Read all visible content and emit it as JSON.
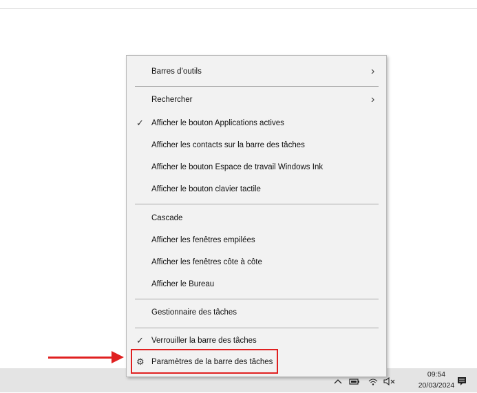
{
  "menu": {
    "items": [
      {
        "label": "Barres d’outils",
        "submenu": true,
        "checked": false
      },
      {
        "label": "Rechercher",
        "submenu": true,
        "checked": false
      },
      {
        "label": "Afficher le bouton Applications actives",
        "submenu": false,
        "checked": true
      },
      {
        "label": "Afficher les contacts sur la barre des tâches",
        "submenu": false,
        "checked": false
      },
      {
        "label": "Afficher le bouton Espace de travail Windows Ink",
        "submenu": false,
        "checked": false
      },
      {
        "label": "Afficher le bouton clavier tactile",
        "submenu": false,
        "checked": false
      },
      {
        "label": "Cascade",
        "submenu": false,
        "checked": false
      },
      {
        "label": "Afficher les fenêtres empilées",
        "submenu": false,
        "checked": false
      },
      {
        "label": "Afficher les fenêtres côte à côte",
        "submenu": false,
        "checked": false
      },
      {
        "label": "Afficher le Bureau",
        "submenu": false,
        "checked": false
      },
      {
        "label": "Gestionnaire des tâches",
        "submenu": false,
        "checked": false
      },
      {
        "label": "Verrouiller la barre des tâches",
        "submenu": false,
        "checked": true
      },
      {
        "label": "Paramètres de la barre des tâches",
        "submenu": false,
        "checked": false,
        "icon": "gear-icon"
      }
    ]
  },
  "taskbar": {
    "time": "09:54",
    "date": "20/03/2024",
    "tray_icons": [
      "chevron-up-icon",
      "battery-icon",
      "wifi-icon",
      "speaker-muted-icon",
      "action-center-icon"
    ]
  },
  "annotation": {
    "highlight_color": "#e02020",
    "highlighted_item": "Paramètres de la barre des tâches"
  }
}
